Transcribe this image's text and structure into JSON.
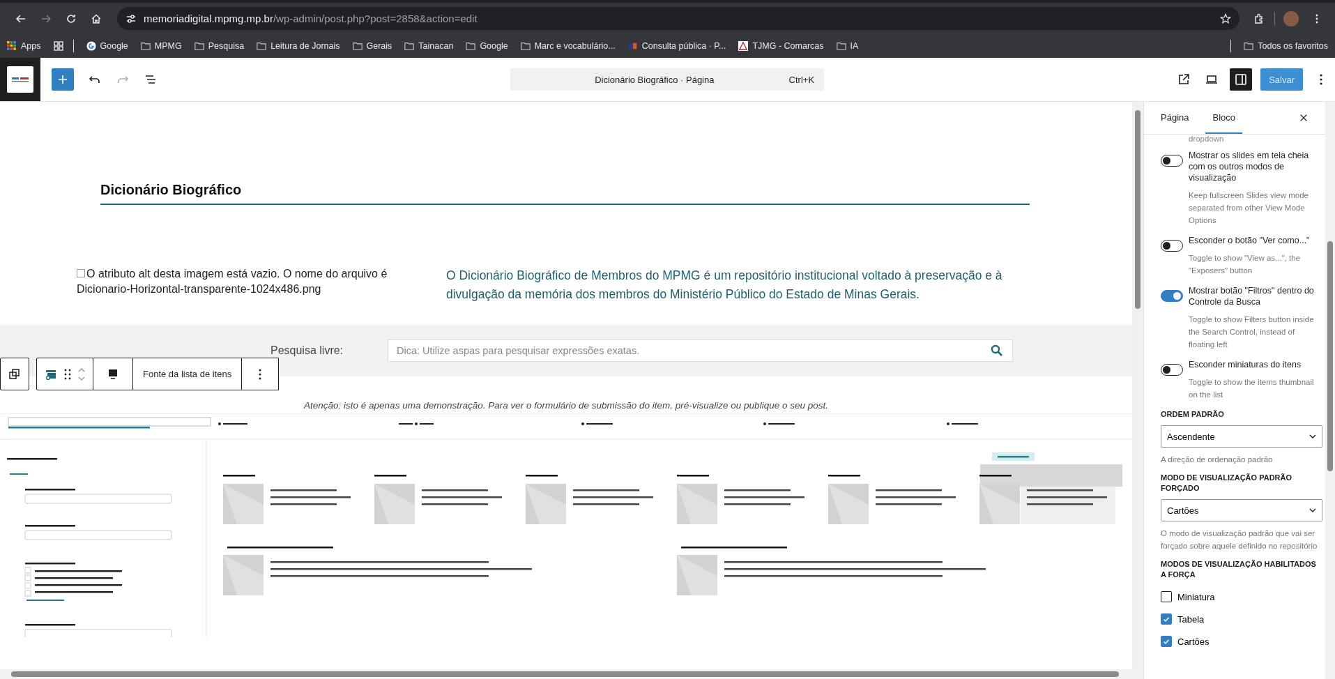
{
  "browser": {
    "url_host": "memoriadigital.mpmg.mp.br",
    "url_path": "/wp-admin/post.php?post=2858&action=edit",
    "bookmarks": [
      {
        "kind": "apps",
        "label": "Apps"
      },
      {
        "kind": "grid"
      },
      {
        "kind": "google",
        "label": "Google"
      },
      {
        "kind": "folder",
        "label": "MPMG"
      },
      {
        "kind": "folder",
        "label": "Pesquisa"
      },
      {
        "kind": "folder",
        "label": "Leitura de Jornais"
      },
      {
        "kind": "folder",
        "label": "Gerais"
      },
      {
        "kind": "folder",
        "label": "Tainacan"
      },
      {
        "kind": "folder",
        "label": "Google"
      },
      {
        "kind": "folder",
        "label": "Marc e vocabulário..."
      },
      {
        "kind": "site",
        "label": "Consulta pública · P..."
      },
      {
        "kind": "triangle",
        "label": "TJMG - Comarcas"
      },
      {
        "kind": "folder",
        "label": "IA"
      }
    ],
    "all_bookmarks": "Todos os favoritos"
  },
  "editor_toolbar": {
    "command": "Dicionário Biográfico · Página",
    "shortcut": "Ctrl+K",
    "save": "Salvar"
  },
  "content": {
    "heading": "Dicionário Biográfico",
    "image_alt": "O atributo alt desta imagem está vazio. O nome do arquivo é Dicionario-Horizontal-transparente-1024x486.png",
    "description": "O Dicionário Biográfico de Membros do MPMG é um repositório institucional voltado à preservação e à divulgação da memória dos membros do Ministério Público do Estado de Minas Gerais.",
    "search_label": "Pesquisa livre:",
    "search": {
      "placeholder": "Dica: Utilize aspas para pesquisar expressões exatas."
    },
    "block_toolbar": {
      "label": "Fonte da lista de itens"
    },
    "notice": "Atenção: isto é apenas uma demonstração. Para ver o formulário de submissão do item, pré-visualize ou publique o seu post."
  },
  "sidebar": {
    "tabs": [
      {
        "label": "Página",
        "selected": false
      },
      {
        "label": "Bloco",
        "selected": true
      }
    ],
    "cut_text": "dropdown",
    "toggles": [
      {
        "label": "Mostrar os slides em tela cheia com os outros modos de visualização",
        "help": "Keep fullscreen Slides view mode separated from other View Mode Options",
        "on": false
      },
      {
        "label": "Esconder o botão \"Ver como...\"",
        "help": "Toggle to show \"View as...\", the \"Exposers\" button",
        "on": false
      },
      {
        "label": "Mostrar botão \"Filtros\" dentro do Controle da Busca",
        "help": "Toggle to show Filters button inside the Search Control, instead of floating left",
        "on": true
      },
      {
        "label": "Esconder miniaturas do itens",
        "help": "Toggle to show the items thumbnail on the list",
        "on": false
      }
    ],
    "selects": [
      {
        "heading": "ORDEM PADRÃO",
        "value": "Ascendente",
        "help": "A direção de ordenação padrão"
      },
      {
        "heading": "MODO DE VISUALIZAÇÃO PADRÃO FORÇADO",
        "value": "Cartões",
        "help": "O modo de visualização padrão que vai ser forçado sobre aquele definido no repositório"
      }
    ],
    "modes_heading": "MODOS DE VISUALIZAÇÃO HABILITADOS A FORÇA",
    "modes": [
      {
        "label": "Miniatura",
        "checked": false
      },
      {
        "label": "Tabela",
        "checked": true
      },
      {
        "label": "Cartões",
        "checked": true
      }
    ]
  }
}
